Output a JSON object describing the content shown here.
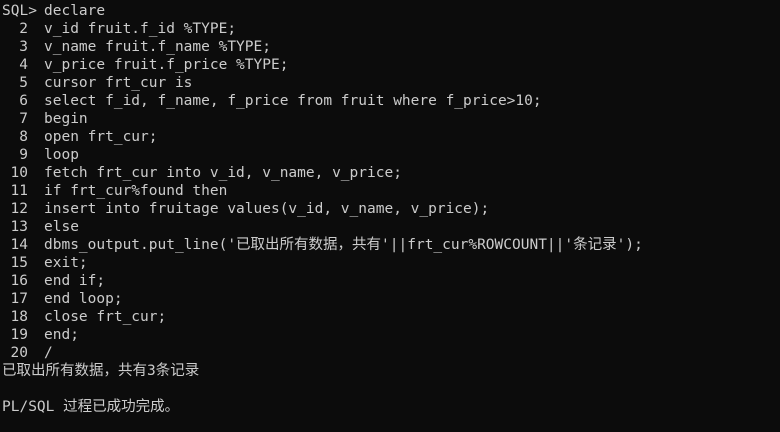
{
  "terminal": {
    "prompt": "SQL>",
    "first_command": "declare",
    "lines": [
      {
        "n": "2",
        "code": "v_id fruit.f_id %TYPE;"
      },
      {
        "n": "3",
        "code": "v_name fruit.f_name %TYPE;"
      },
      {
        "n": "4",
        "code": "v_price fruit.f_price %TYPE;"
      },
      {
        "n": "5",
        "code": "cursor frt_cur is"
      },
      {
        "n": "6",
        "code": "select f_id, f_name, f_price from fruit where f_price>10;"
      },
      {
        "n": "7",
        "code": "begin"
      },
      {
        "n": "8",
        "code": "open frt_cur;"
      },
      {
        "n": "9",
        "code": "loop"
      },
      {
        "n": "10",
        "code": "fetch frt_cur into v_id, v_name, v_price;"
      },
      {
        "n": "11",
        "code": "if frt_cur%found then"
      },
      {
        "n": "12",
        "code": "insert into fruitage values(v_id, v_name, v_price);"
      },
      {
        "n": "13",
        "code": "else"
      },
      {
        "n": "14",
        "code": "dbms_output.put_line('已取出所有数据，共有'||frt_cur%ROWCOUNT||'条记录');"
      },
      {
        "n": "15",
        "code": "exit;"
      },
      {
        "n": "16",
        "code": "end if;"
      },
      {
        "n": "17",
        "code": "end loop;"
      },
      {
        "n": "18",
        "code": "close frt_cur;"
      },
      {
        "n": "19",
        "code": "end;"
      },
      {
        "n": "20",
        "code": "/"
      }
    ],
    "output_line": "已取出所有数据，共有3条记录",
    "completion_message": "PL/SQL 过程已成功完成。"
  }
}
